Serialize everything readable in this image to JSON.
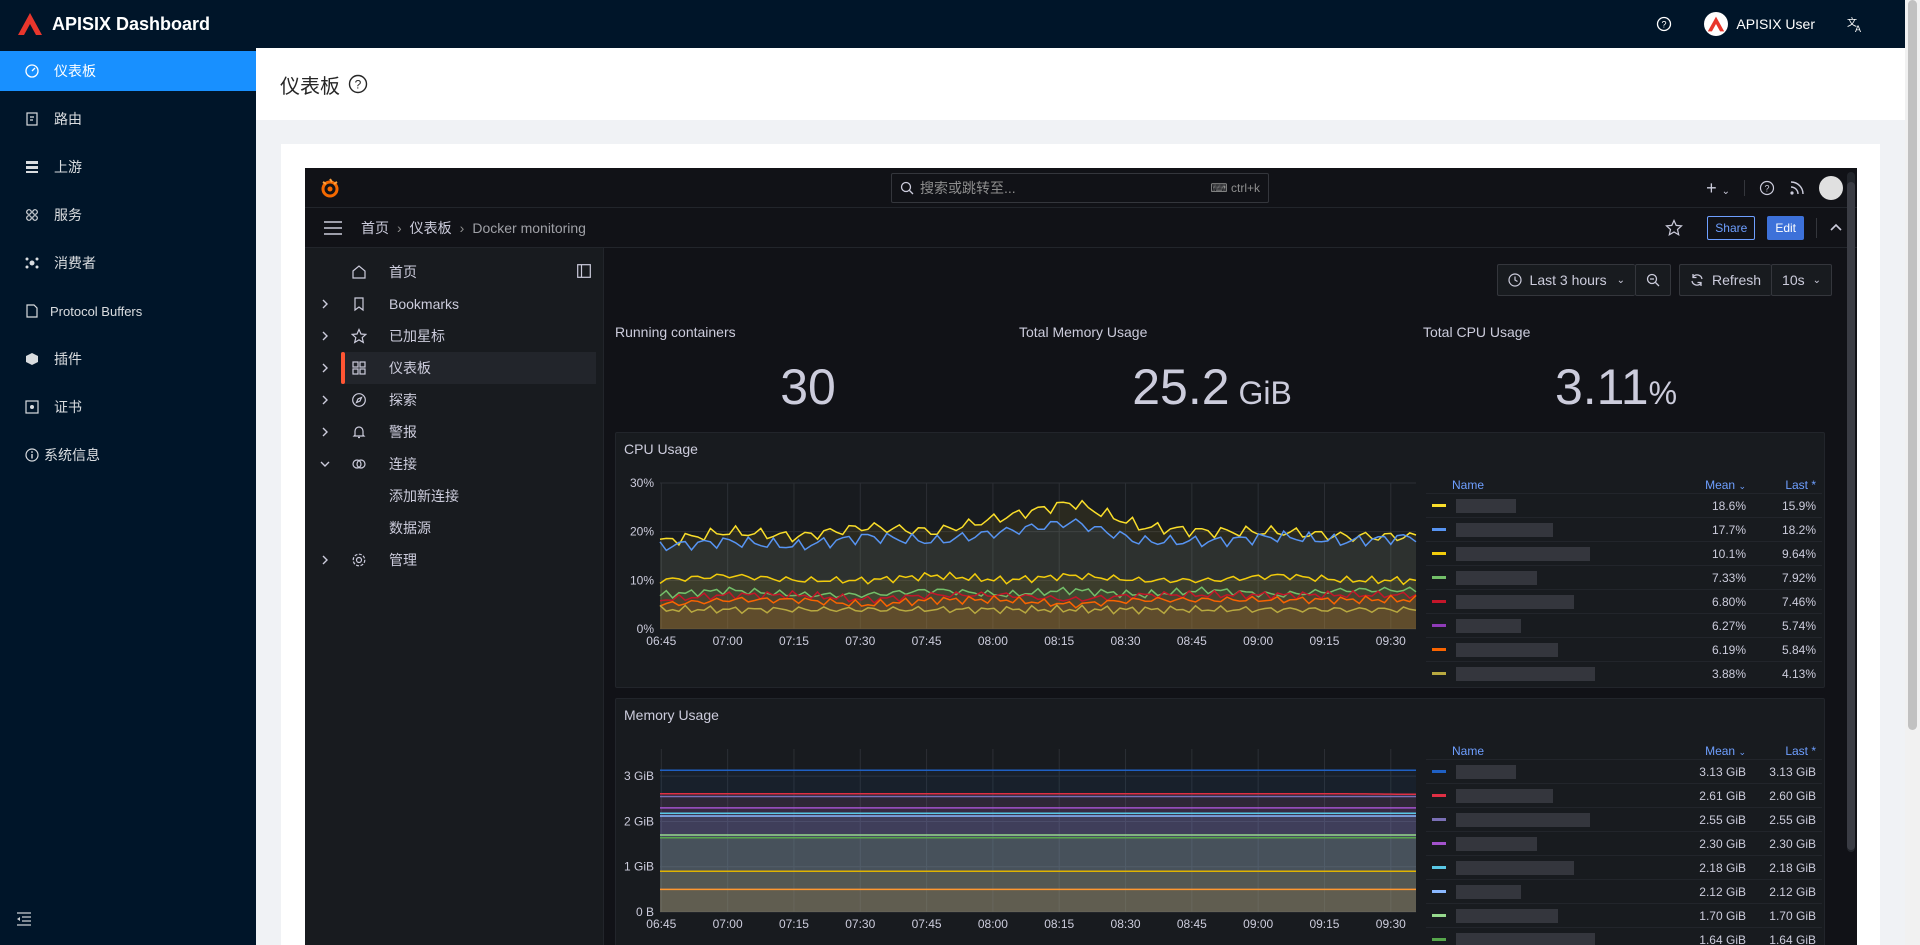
{
  "app": {
    "title": "APISIX Dashboard",
    "user": "APISIX User",
    "colors": {
      "accent": "#1890ff",
      "sider": "#001529",
      "brand_red": "#e8362c"
    }
  },
  "sidebar": {
    "items": [
      {
        "label": "仪表板",
        "icon": "dashboard-icon",
        "active": true
      },
      {
        "label": "路由",
        "icon": "route-icon"
      },
      {
        "label": "上游",
        "icon": "upstream-icon"
      },
      {
        "label": "服务",
        "icon": "service-icon"
      },
      {
        "label": "消费者",
        "icon": "consumer-icon"
      },
      {
        "label": "Protocol Buffers",
        "icon": "file-icon"
      },
      {
        "label": "插件",
        "icon": "plugin-icon"
      },
      {
        "label": "证书",
        "icon": "certificate-icon"
      },
      {
        "label": "系统信息",
        "icon": "info-icon"
      }
    ]
  },
  "page": {
    "title": "仪表板"
  },
  "grafana": {
    "search_placeholder": "搜索或跳转至...",
    "search_shortcut": "ctrl+k",
    "breadcrumb": [
      "首页",
      "仪表板",
      "Docker monitoring"
    ],
    "share_label": "Share",
    "edit_label": "Edit",
    "nav": [
      {
        "label": "首页",
        "icon": "home-icon",
        "chevron": false
      },
      {
        "label": "Bookmarks",
        "icon": "bookmark-icon",
        "chevron": "right"
      },
      {
        "label": "已加星标",
        "icon": "star-icon",
        "chevron": "right"
      },
      {
        "label": "仪表板",
        "icon": "apps-icon",
        "chevron": "right",
        "active": true
      },
      {
        "label": "探索",
        "icon": "compass-icon",
        "chevron": "right"
      },
      {
        "label": "警报",
        "icon": "bell-icon",
        "chevron": "right"
      },
      {
        "label": "连接",
        "icon": "link-icon",
        "chevron": "down"
      },
      {
        "label": "添加新连接",
        "sub": true
      },
      {
        "label": "数据源",
        "sub": true
      },
      {
        "label": "管理",
        "icon": "cog-icon",
        "chevron": "right"
      }
    ],
    "time_range": "Last 3 hours",
    "refresh_label": "Refresh",
    "refresh_interval": "10s",
    "stats": [
      {
        "title": "Running containers",
        "value": "30",
        "unit": ""
      },
      {
        "title": "Total Memory Usage",
        "value": "25.2",
        "unit": " GiB"
      },
      {
        "title": "Total CPU Usage",
        "value": "3.11",
        "unit": "%"
      }
    ],
    "cpu_panel": {
      "title": "CPU Usage",
      "legend_headers": {
        "name": "Name",
        "mean": "Mean",
        "last": "Last *"
      },
      "rows": [
        {
          "color": "#fade2a",
          "mean": "18.6%",
          "last": "15.9%"
        },
        {
          "color": "#5794f2",
          "mean": "17.7%",
          "last": "18.2%"
        },
        {
          "color": "#f2cc0c",
          "mean": "10.1%",
          "last": "9.64%"
        },
        {
          "color": "#73bf69",
          "mean": "7.33%",
          "last": "7.92%"
        },
        {
          "color": "#c4162a",
          "mean": "6.80%",
          "last": "7.46%"
        },
        {
          "color": "#8f3bb8",
          "mean": "6.27%",
          "last": "5.74%"
        },
        {
          "color": "#fa6400",
          "mean": "6.19%",
          "last": "5.84%"
        },
        {
          "color": "#b8a940",
          "mean": "3.88%",
          "last": "4.13%"
        }
      ]
    },
    "memory_panel": {
      "title": "Memory Usage",
      "legend_headers": {
        "name": "Name",
        "mean": "Mean",
        "last": "Last *"
      },
      "rows": [
        {
          "color": "#1f60c4",
          "mean": "3.13 GiB",
          "last": "3.13 GiB"
        },
        {
          "color": "#e02f44",
          "mean": "2.61 GiB",
          "last": "2.60 GiB"
        },
        {
          "color": "#7a6fb5",
          "mean": "2.55 GiB",
          "last": "2.55 GiB"
        },
        {
          "color": "#a352cc",
          "mean": "2.30 GiB",
          "last": "2.30 GiB"
        },
        {
          "color": "#5ac8e6",
          "mean": "2.18 GiB",
          "last": "2.18 GiB"
        },
        {
          "color": "#8ab8ff",
          "mean": "2.12 GiB",
          "last": "2.12 GiB"
        },
        {
          "color": "#96d98d",
          "mean": "1.70 GiB",
          "last": "1.70 GiB"
        },
        {
          "color": "#56a64b",
          "mean": "1.64 GiB",
          "last": "1.64 GiB"
        }
      ]
    },
    "cpu_chart": {
      "type": "line",
      "x": [
        "06:45",
        "07:00",
        "07:15",
        "07:30",
        "07:45",
        "08:00",
        "08:15",
        "08:30",
        "08:45",
        "09:00",
        "09:15",
        "09:30"
      ],
      "yticks": [
        "0%",
        "10%",
        "20%",
        "30%"
      ],
      "ylim": [
        0,
        30
      ],
      "series": [
        {
          "color": "#fade2a",
          "values": [
            18,
            20,
            19,
            21,
            20,
            23,
            26,
            21,
            20,
            20,
            19,
            19
          ]
        },
        {
          "color": "#5794f2",
          "values": [
            17,
            18,
            17,
            19,
            18,
            20,
            22,
            18,
            18,
            19,
            18,
            19
          ]
        },
        {
          "color": "#f2cc0c",
          "values": [
            10,
            11,
            10,
            10,
            11,
            10,
            11,
            10,
            10,
            11,
            10,
            10
          ]
        },
        {
          "color": "#73bf69",
          "values": [
            7,
            8,
            7,
            7,
            8,
            7,
            8,
            7,
            8,
            7,
            8,
            8
          ]
        },
        {
          "color": "#c4162a",
          "values": [
            6,
            7,
            7,
            6,
            7,
            7,
            6,
            7,
            7,
            7,
            7,
            7
          ]
        },
        {
          "color": "#fa6400",
          "values": [
            5,
            6,
            6,
            5,
            6,
            6,
            5,
            6,
            6,
            6,
            6,
            6
          ]
        },
        {
          "color": "#b8a940",
          "values": [
            4,
            4,
            4,
            4,
            4,
            4,
            4,
            4,
            4,
            4,
            4,
            4
          ]
        }
      ]
    },
    "memory_chart": {
      "type": "area",
      "x": [
        "06:45",
        "07:00",
        "07:15",
        "07:30",
        "07:45",
        "08:00",
        "08:15",
        "08:30",
        "08:45",
        "09:00",
        "09:15",
        "09:30"
      ],
      "yticks": [
        "0 B",
        "1 GiB",
        "2 GiB",
        "3 GiB"
      ],
      "ylim": [
        0,
        3.6
      ],
      "series": [
        {
          "color": "#1f60c4",
          "values": [
            3.13,
            3.13,
            3.13,
            3.13,
            3.13,
            3.13,
            3.13,
            3.13,
            3.13,
            3.13,
            3.13,
            3.13
          ]
        },
        {
          "color": "#e02f44",
          "values": [
            2.61,
            2.61,
            2.61,
            2.61,
            2.61,
            2.61,
            2.61,
            2.61,
            2.61,
            2.61,
            2.61,
            2.6
          ]
        },
        {
          "color": "#7a6fb5",
          "values": [
            2.55,
            2.55,
            2.55,
            2.55,
            2.55,
            2.55,
            2.55,
            2.55,
            2.55,
            2.55,
            2.55,
            2.55
          ]
        },
        {
          "color": "#a352cc",
          "values": [
            2.3,
            2.3,
            2.3,
            2.3,
            2.3,
            2.3,
            2.3,
            2.3,
            2.3,
            2.3,
            2.3,
            2.3
          ]
        },
        {
          "color": "#5ac8e6",
          "values": [
            2.18,
            2.18,
            2.18,
            2.18,
            2.18,
            2.18,
            2.18,
            2.18,
            2.18,
            2.18,
            2.18,
            2.18
          ]
        },
        {
          "color": "#8ab8ff",
          "values": [
            2.12,
            2.12,
            2.12,
            2.12,
            2.12,
            2.12,
            2.12,
            2.12,
            2.12,
            2.12,
            2.12,
            2.12
          ]
        },
        {
          "color": "#96d98d",
          "values": [
            1.7,
            1.7,
            1.7,
            1.7,
            1.7,
            1.7,
            1.7,
            1.7,
            1.7,
            1.7,
            1.7,
            1.7
          ]
        },
        {
          "color": "#56a64b",
          "values": [
            1.64,
            1.64,
            1.64,
            1.64,
            1.64,
            1.64,
            1.64,
            1.64,
            1.64,
            1.64,
            1.64,
            1.64
          ]
        },
        {
          "color": "#e0b400",
          "values": [
            0.9,
            0.9,
            0.9,
            0.9,
            0.9,
            0.9,
            0.9,
            0.9,
            0.9,
            0.9,
            0.9,
            0.9
          ]
        },
        {
          "color": "#ff9830",
          "values": [
            0.5,
            0.5,
            0.5,
            0.5,
            0.5,
            0.5,
            0.5,
            0.5,
            0.5,
            0.5,
            0.5,
            0.5
          ]
        }
      ]
    }
  }
}
